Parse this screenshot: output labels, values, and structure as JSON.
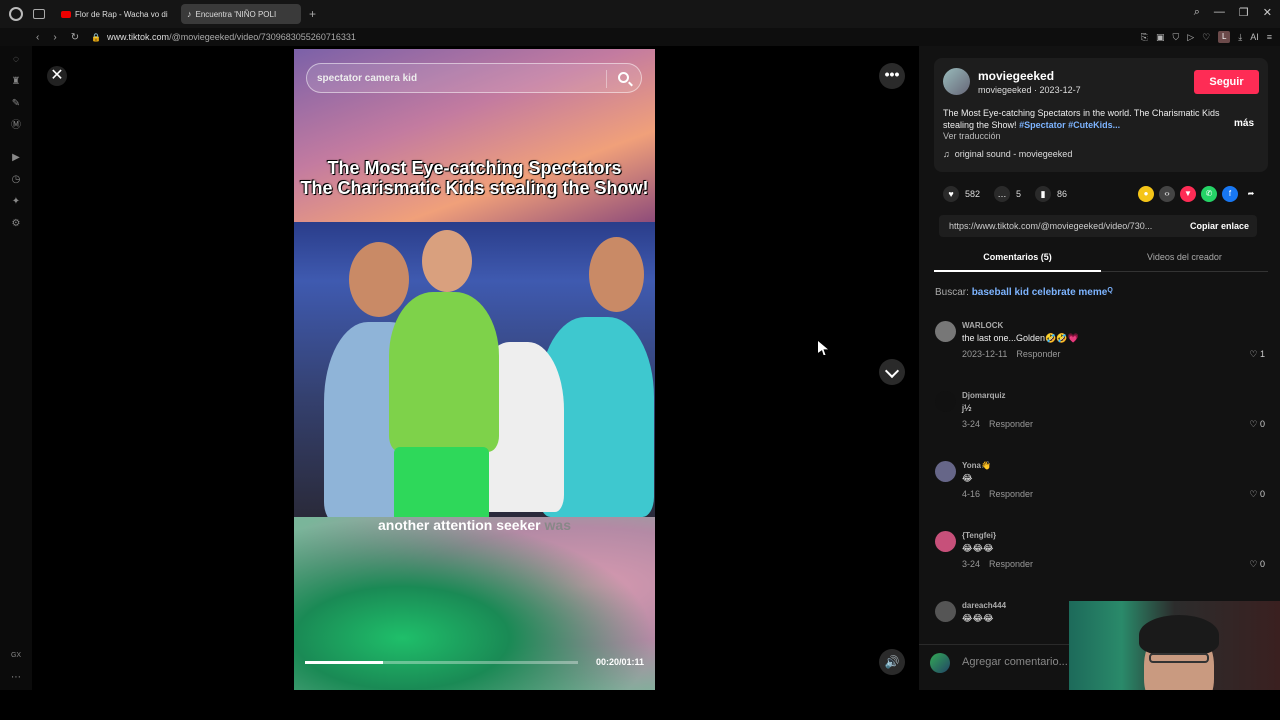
{
  "browser": {
    "tabs": [
      {
        "label": "Flor de Rap - Wacha vo di",
        "icon": "youtube-icon"
      },
      {
        "label": "Encuentra 'NIÑO POLI",
        "icon": "tiktok-icon",
        "active": true
      }
    ],
    "url_host": "www.tiktok.com",
    "url_path": "/@moviegeeked/video/7309683055260716331",
    "profile_initial": "L",
    "ai_label": "AI",
    "gx_label": "GX"
  },
  "video": {
    "search_text": "spectator camera kid",
    "caption_line1": "The Most Eye-catching Spectators",
    "caption_line2": "The Charismatic Kids stealing the Show!",
    "subtitle_main": "another attention seeker",
    "subtitle_dim": "was",
    "time": "00:20/01:11",
    "progress": 0.285
  },
  "author": {
    "display_name": "moviegeeked",
    "handle": "moviegeeked",
    "date": "2023-12-7",
    "follow_label": "Seguir",
    "description": "The Most Eye-catching Spectators in the world. The Charismatic Kids stealing the Show!",
    "hashtags": "#Spectator #CuteKids...",
    "more_label": "más",
    "translate_label": "Ver traducción",
    "sound": "original sound - moviegeeked"
  },
  "stats": {
    "likes": "582",
    "comments": "5",
    "saves": "86"
  },
  "share": {
    "link": "https://www.tiktok.com/@moviegeeked/video/730...",
    "copy_label": "Copiar enlace",
    "colors": [
      "#f5c518",
      "#444444",
      "#fe2c55",
      "#25d366",
      "#1877f2"
    ]
  },
  "tabs": {
    "comments": "Comentarios (5)",
    "creator_videos": "Videos del creador"
  },
  "search_suggestion": {
    "label": "Buscar:",
    "query": "baseball kid celebrate meme"
  },
  "comments": [
    {
      "name": "WARLOCK",
      "text": "the last one...Golden🤣🤣💗",
      "date": "2023-12-11",
      "reply": "Responder",
      "likes": "1",
      "avatar_color": "#777777"
    },
    {
      "name": "Djomarquiz",
      "text": "j½",
      "date": "3-24",
      "reply": "Responder",
      "likes": "0",
      "avatar_color": "#111111"
    },
    {
      "name": "Yona👋",
      "text": "😂",
      "date": "4-16",
      "reply": "Responder",
      "likes": "0",
      "avatar_color": "#666688"
    },
    {
      "name": "{Tengfei}",
      "text": "😂😂😂",
      "date": "3-24",
      "reply": "Responder",
      "likes": "0",
      "avatar_color": "#c7507a"
    },
    {
      "name": "dareach444",
      "text": "😂😂😂",
      "date": "",
      "reply": "",
      "likes": "",
      "avatar_color": "#555555"
    }
  ],
  "add_comment_placeholder": "Agregar comentario..."
}
